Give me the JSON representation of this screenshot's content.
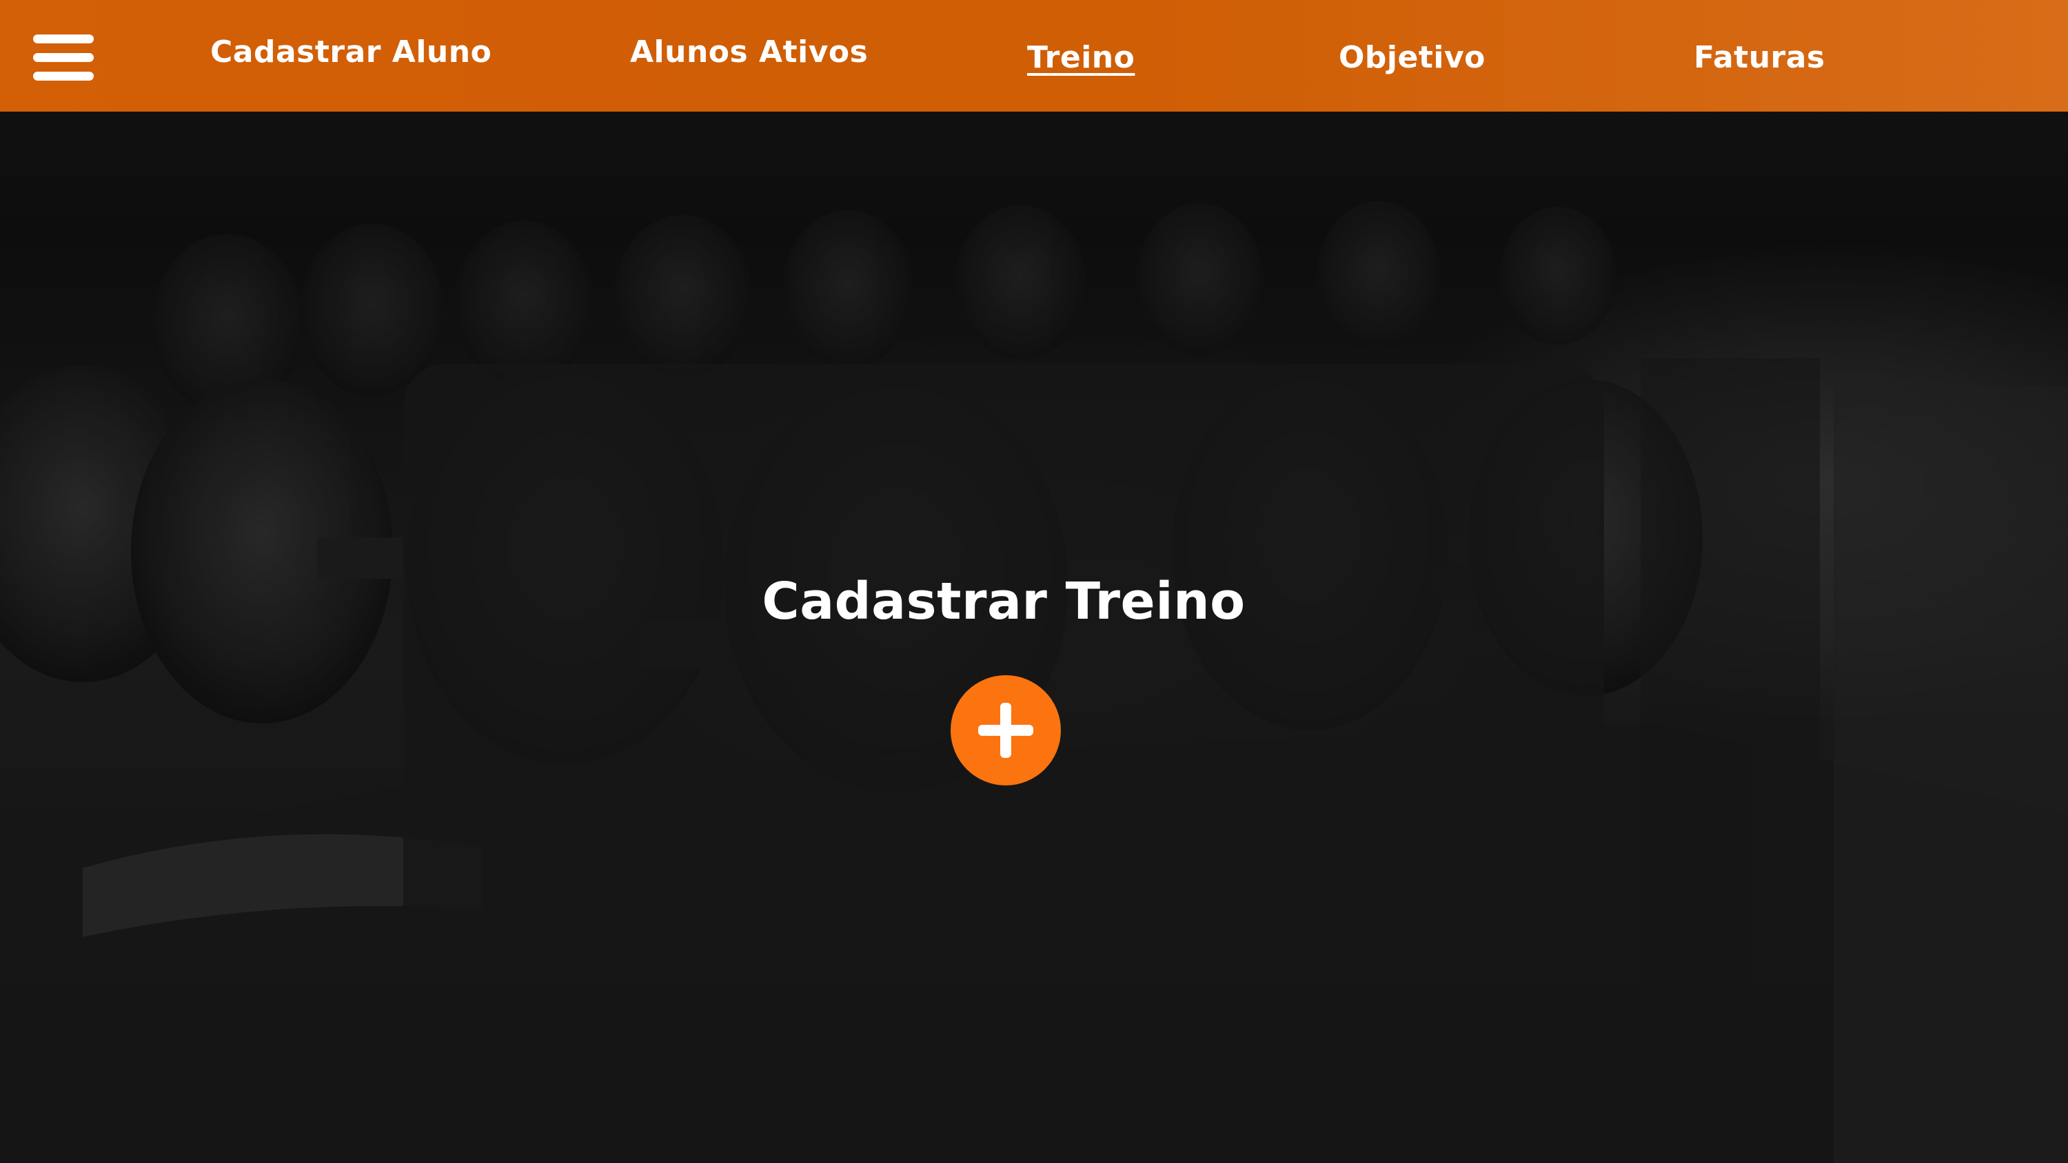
{
  "nav": {
    "menu_icon": "hamburger-menu-icon",
    "items": [
      {
        "label": "Cadastrar Aluno",
        "active": false
      },
      {
        "label": "Alunos Ativos",
        "active": false
      },
      {
        "label": "Treino",
        "active": true
      },
      {
        "label": "Objetivo",
        "active": false
      },
      {
        "label": "Faturas",
        "active": false
      }
    ]
  },
  "card": {
    "title": "Cadastrar Treino",
    "add_icon": "plus-circle-icon"
  },
  "colors": {
    "navbar": "#d35f06",
    "accent_button": "#fb7410",
    "text": "#ffffff",
    "card_background": "#161616"
  }
}
